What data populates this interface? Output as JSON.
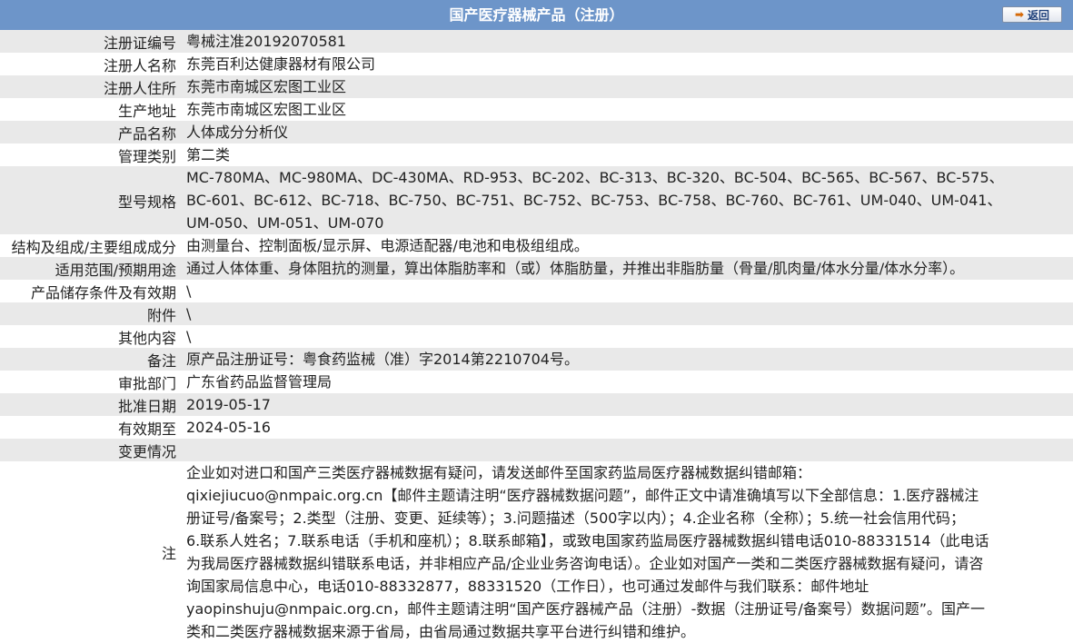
{
  "header": {
    "title": "国产医疗器械产品（注册）",
    "back_label": "返回"
  },
  "rows": [
    {
      "label": "注册证编号",
      "value": "粤械注准20192070581"
    },
    {
      "label": "注册人名称",
      "value": "东莞百利达健康器材有限公司"
    },
    {
      "label": "注册人住所",
      "value": "东莞市南城区宏图工业区"
    },
    {
      "label": "生产地址",
      "value": "东莞市南城区宏图工业区"
    },
    {
      "label": "产品名称",
      "value": "人体成分分析仪"
    },
    {
      "label": "管理类别",
      "value": "第二类"
    },
    {
      "label": "型号规格",
      "lines": [
        "MC-780MA、MC-980MA、DC-430MA、RD-953、BC-202、BC-313、BC-320、BC-504、BC-565、BC-567、BC-575、",
        "BC-601、BC-612、BC-718、BC-750、BC-751、BC-752、BC-753、BC-758、BC-760、BC-761、UM-040、UM-041、",
        "UM-050、UM-051、UM-070"
      ]
    },
    {
      "label": "结构及组成/主要组成成分",
      "value": "由测量台、控制面板/显示屏、电源适配器/电池和电极组组成。"
    },
    {
      "label": "适用范围/预期用途",
      "value": "通过人体体重、身体阻抗的测量，算出体脂肪率和（或）体脂肪量，并推出非脂肪量（骨量/肌肉量/体水分量/体水分率）。"
    },
    {
      "label": "产品储存条件及有效期",
      "value": "\\"
    },
    {
      "label": "附件",
      "value": "\\"
    },
    {
      "label": "其他内容",
      "value": "\\"
    },
    {
      "label": "备注",
      "value": "原产品注册证号：粤食药监械（准）字2014第2210704号。"
    },
    {
      "label": "审批部门",
      "value": "广东省药品监督管理局"
    },
    {
      "label": "批准日期",
      "value": "2019-05-17"
    },
    {
      "label": "有效期至",
      "value": "2024-05-16"
    },
    {
      "label": "变更情况",
      "value": ""
    }
  ],
  "note": {
    "label": "注",
    "lines": [
      "企业如对进口和国产三类医疗器械数据有疑问，请发送邮件至国家药监局医疗器械数据纠错邮箱：",
      "qixiejiucuo@nmpaic.org.cn【邮件主题请注明“医疗器械数据问题”，邮件正文中请准确填写以下全部信息：1.医疗器械注",
      "册证号/备案号；2.类型（注册、变更、延续等）；3.问题描述（500字以内）；4.企业名称（全称）；5.统一社会信用代码；",
      "6.联系人姓名；7.联系电话（手机和座机）；8.联系邮箱】，或致电国家药监局医疗器械数据纠错电话010-88331514（此电话",
      "为我局医疗器械数据纠错联系电话，并非相应产品/企业业务咨询电话）。企业如对国产一类和二类医疗器械数据有疑问，请咨",
      "询国家局信息中心，电话010-88332877，88331520（工作日），也可通过发邮件与我们联系：邮件地址",
      "yaopinshuju@nmpaic.org.cn，邮件主题请注明“国产医疗器械产品（注册）-数据（注册证号/备案号）数据问题”。国产一",
      "类和二类医疗器械数据来源于省局，由省局通过数据共享平台进行纠错和维护。"
    ]
  }
}
